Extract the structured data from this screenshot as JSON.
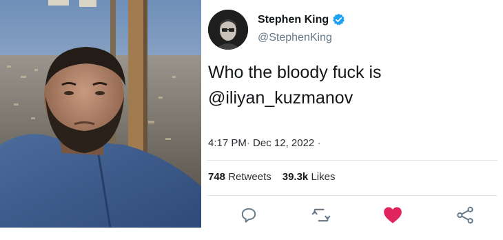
{
  "tweet": {
    "author_name": "Stephen King",
    "handle": "@StephenKing",
    "text_line1": "Who the bloody fuck is",
    "text_line2": "@iliyan_kuzmanov",
    "time": "4:17 PM",
    "date": "Dec 12, 2022",
    "separator": "·",
    "retweets_count": "748",
    "retweets_label": "Retweets",
    "likes_count": "39.3k",
    "likes_label": "Likes"
  },
  "icons": {
    "verified": "verified-badge-icon",
    "reply": "reply-icon",
    "retweet": "retweet-icon",
    "like": "heart-icon",
    "share": "share-icon"
  },
  "colors": {
    "verified": "#1da1f2",
    "like": "#e0245e",
    "action_gray": "#657786"
  }
}
